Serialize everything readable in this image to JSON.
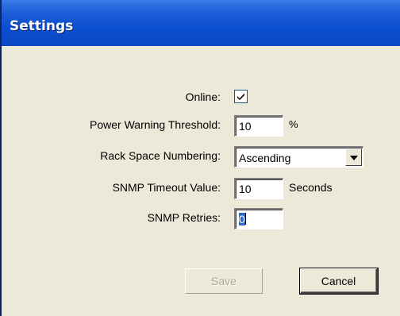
{
  "window": {
    "title": "Settings"
  },
  "form": {
    "online": {
      "label": "Online:",
      "checked": true
    },
    "power_warning": {
      "label": "Power Warning Threshold:",
      "value": "10",
      "unit": "%"
    },
    "rack_space": {
      "label": "Rack Space Numbering:",
      "value": "Ascending"
    },
    "snmp_timeout": {
      "label": "SNMP Timeout Value:",
      "value": "10",
      "unit": "Seconds"
    },
    "snmp_retries": {
      "label": "SNMP Retries:",
      "value": "0"
    }
  },
  "buttons": {
    "save_label": "Save",
    "cancel_label": "Cancel"
  },
  "icons": {
    "checkbox_mark": "checkmark-icon",
    "dropdown_arrow": "chevron-down-icon"
  }
}
